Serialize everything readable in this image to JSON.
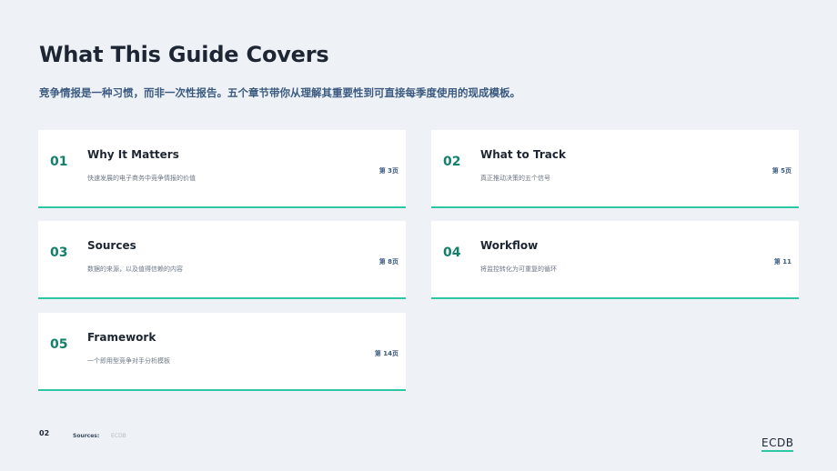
{
  "header": {
    "title": "What This Guide Covers",
    "subtitle": "竞争情报是一种习惯，而非一次性报告。五个章节带你从理解其重要性到可直接每季度使用的现成模板。"
  },
  "chapters": [
    {
      "number": "01",
      "title": "Why It Matters",
      "description": "快速发展的电子商务中竞争情报的价值",
      "page": "第 3页"
    },
    {
      "number": "02",
      "title": "What to Track",
      "description": "真正推动决策的五个信号",
      "page": "第 5页"
    },
    {
      "number": "03",
      "title": "Sources",
      "description": "数据的来源，以及值得信赖的内容",
      "page": "第 8页"
    },
    {
      "number": "04",
      "title": "Workflow",
      "description": "将监控转化为可重复的循环",
      "page": "第 11"
    },
    {
      "number": "05",
      "title": "Framework",
      "description": "一个即用型竞争对手分析模板",
      "page": "第 14页"
    }
  ],
  "footer": {
    "page_number": "02",
    "sources_label": "Sources:",
    "sources_value": "ECDB",
    "logo": "ECDB"
  },
  "colors": {
    "accent": "#2fc6a3",
    "number": "#12806a",
    "subtitle": "#3b5a80",
    "background": "#eef1f6"
  }
}
